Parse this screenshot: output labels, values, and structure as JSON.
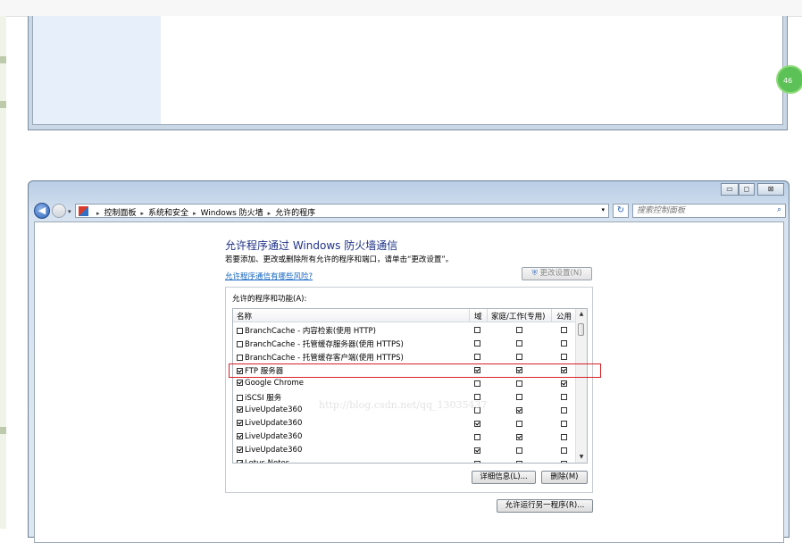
{
  "badge": {
    "count": "46"
  },
  "window": {
    "controls": {
      "minimize": "▭",
      "maximize": "◻",
      "close": "⊠"
    },
    "nav": {
      "back": "◀",
      "dropdown": "▾"
    },
    "breadcrumbs": [
      "控制面板",
      "系统和安全",
      "Windows 防火墙",
      "允许的程序"
    ],
    "breadcrumb_sep": "▸",
    "refresh": "↻",
    "search": {
      "placeholder": "搜索控制面板",
      "icon": "⌕"
    }
  },
  "page": {
    "title": "允许程序通过 Windows 防火墙通信",
    "subtitle": "若要添加、更改或删除所有允许的程序和端口，请单击“更改设置”。",
    "risk_link": "允许程序通信有哪些风险?",
    "change_settings": "更改设置(N)",
    "group_label": "允许的程序和功能(A):",
    "columns": {
      "name": "名称",
      "domain": "域",
      "home": "家庭/工作(专用)",
      "public": "公用"
    },
    "rows": [
      {
        "name": "BranchCache - 内容检索(使用 HTTP)",
        "enabled": false,
        "domain": false,
        "home": false,
        "public": false
      },
      {
        "name": "BranchCache - 托管缓存服务器(使用 HTTPS)",
        "enabled": false,
        "domain": false,
        "home": false,
        "public": false
      },
      {
        "name": "BranchCache - 托管缓存客户端(使用 HTTPS)",
        "enabled": false,
        "domain": false,
        "home": false,
        "public": false
      },
      {
        "name": "FTP 服务器",
        "enabled": true,
        "domain": true,
        "home": true,
        "public": true
      },
      {
        "name": "Google Chrome",
        "enabled": true,
        "domain": false,
        "home": false,
        "public": true
      },
      {
        "name": "iSCSI 服务",
        "enabled": false,
        "domain": false,
        "home": false,
        "public": false
      },
      {
        "name": "LiveUpdate360",
        "enabled": true,
        "domain": false,
        "home": true,
        "public": false
      },
      {
        "name": "LiveUpdate360",
        "enabled": true,
        "domain": true,
        "home": false,
        "public": false
      },
      {
        "name": "LiveUpdate360",
        "enabled": true,
        "domain": false,
        "home": true,
        "public": false
      },
      {
        "name": "LiveUpdate360",
        "enabled": true,
        "domain": true,
        "home": false,
        "public": false
      },
      {
        "name": "Lotus Notes",
        "enabled": true,
        "domain": false,
        "home": false,
        "public": false
      }
    ],
    "details_button": "详细信息(L)...",
    "remove_button": "删除(M)",
    "allow_another": "允许运行另一程序(R)...",
    "watermark": "http://blog.csdn.net/qq_13035437"
  }
}
